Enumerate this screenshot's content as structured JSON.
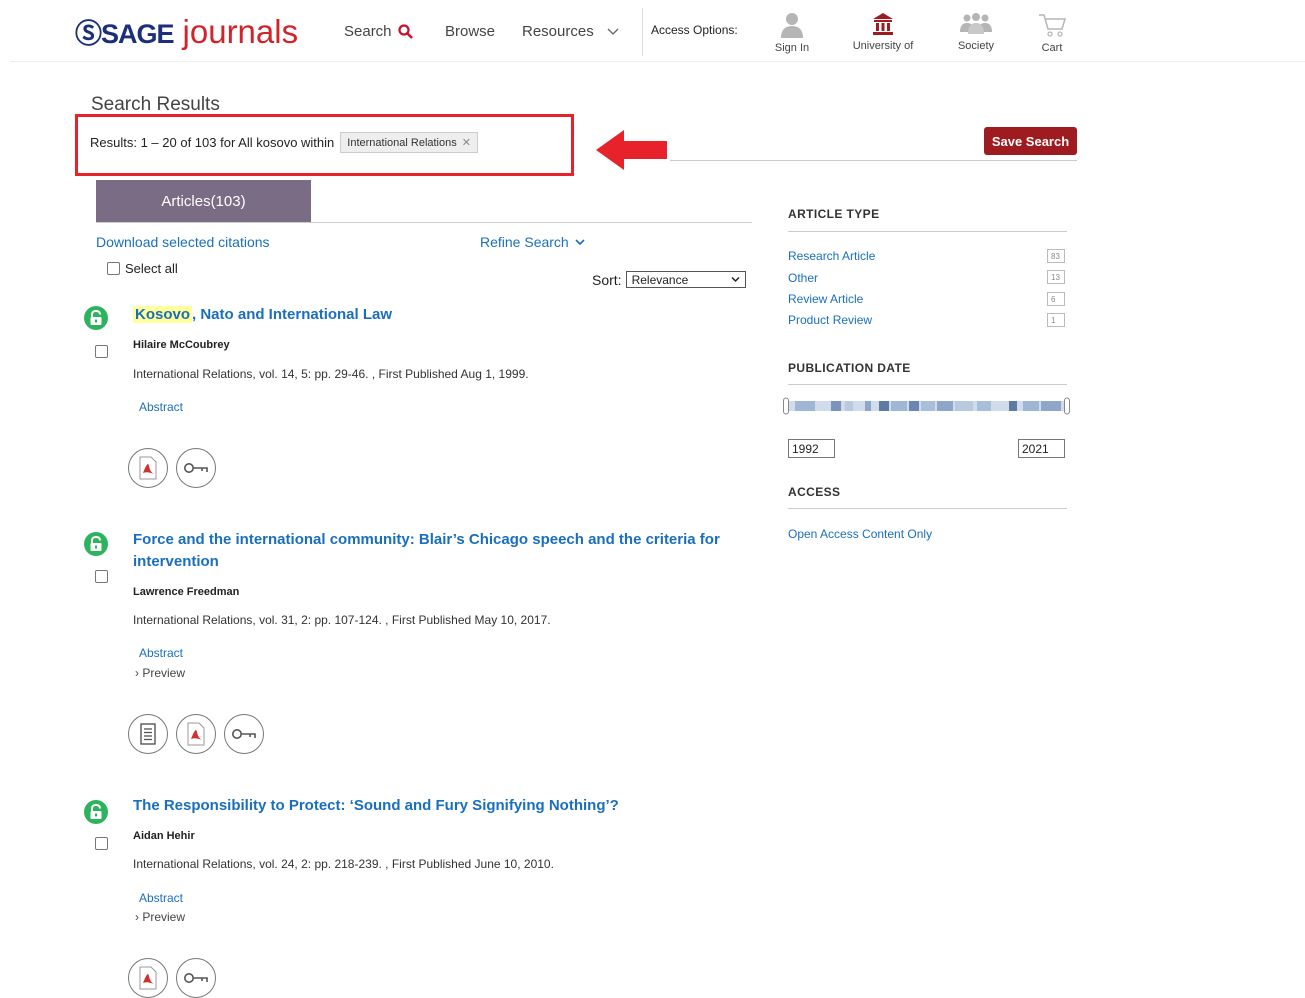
{
  "header": {
    "logo_sage": "SAGE",
    "logo_journals": "journals",
    "nav_search": "Search",
    "nav_browse": "Browse",
    "nav_resources": "Resources",
    "access_label": "Access Options:",
    "signin_label": "Sign In",
    "university_label": "University of",
    "society_label": "Society",
    "cart_label": "Cart"
  },
  "search": {
    "title": "Search Results",
    "results_prefix": "Results:",
    "results_text": "1 – 20 of 103 for All kosovo within",
    "filter_tag": "International Relations",
    "save_label": "Save Search"
  },
  "tabs": {
    "articles_label": "Articles(103)"
  },
  "controls": {
    "download_label": "Download selected citations",
    "refine_label": "Refine Search",
    "select_all_label": "Select all",
    "sort_label": "Sort:",
    "sort_value": "Relevance"
  },
  "results": [
    {
      "title_highlight": "Kosovo",
      "title_rest": ", Nato and International Law",
      "author": "Hilaire McCoubrey",
      "meta": "International Relations, vol. 14, 5: pp. 29-46. , First Published Aug 1, 1999.",
      "abstract": "Abstract"
    },
    {
      "title_line1": "Force and the international community: Blair’s Chicago speech and the criteria for",
      "title_line2": "intervention",
      "author": "Lawrence Freedman",
      "meta": "International Relations, vol. 31, 2: pp. 107-124. , First Published May 10, 2017.",
      "abstract": "Abstract",
      "preview": "› Preview"
    },
    {
      "title": "The Responsibility to Protect: ‘Sound and Fury Signifying Nothing’?",
      "author": "Aidan Hehir",
      "meta": "International Relations, vol. 24, 2: pp. 218-239. , First Published June 10, 2010.",
      "abstract": "Abstract",
      "preview": "› Preview"
    }
  ],
  "sidebar": {
    "article_type_heading": "ARTICLE TYPE",
    "article_types": [
      {
        "label": "Research Article",
        "count": "83"
      },
      {
        "label": "Other",
        "count": "13"
      },
      {
        "label": "Review Article",
        "count": "6"
      },
      {
        "label": "Product Review",
        "count": "1"
      }
    ],
    "pubdate_heading": "PUBLICATION DATE",
    "year_from": "1992",
    "year_to": "2021",
    "access_heading": "ACCESS",
    "open_access_label": "Open Access Content Only"
  },
  "colors": {
    "accent_blue": "#1a6fbd",
    "brand_red": "#9e1b20",
    "annotation_red": "#e8222a",
    "tab_purple": "#7a6c84",
    "open_access_green": "#2db35d"
  }
}
